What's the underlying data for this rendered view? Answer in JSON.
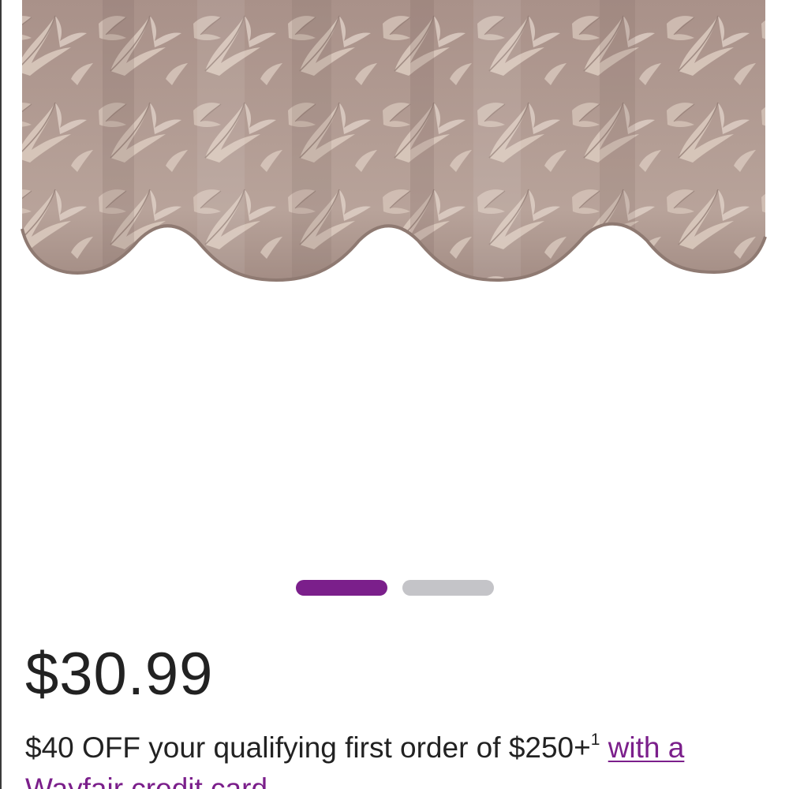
{
  "product": {
    "image_alt": "Scalloped jacquard leaf-pattern valance in taupe",
    "colors": {
      "fabric_base": "#b39d94",
      "fabric_light": "#dccbc0",
      "fabric_dark": "#8a746c",
      "background": "#ffffff"
    }
  },
  "carousel": {
    "total_slides": 2,
    "active_index": 0,
    "active_color": "#7b1f8b",
    "inactive_color": "#c4c4c8"
  },
  "pricing": {
    "price": "$30.99"
  },
  "promo": {
    "text": "$40 OFF your qualifying first order of $250+",
    "footnote": "1",
    "link_text": "with a Wayfair credit card",
    "link_color": "#7b1f8b"
  }
}
